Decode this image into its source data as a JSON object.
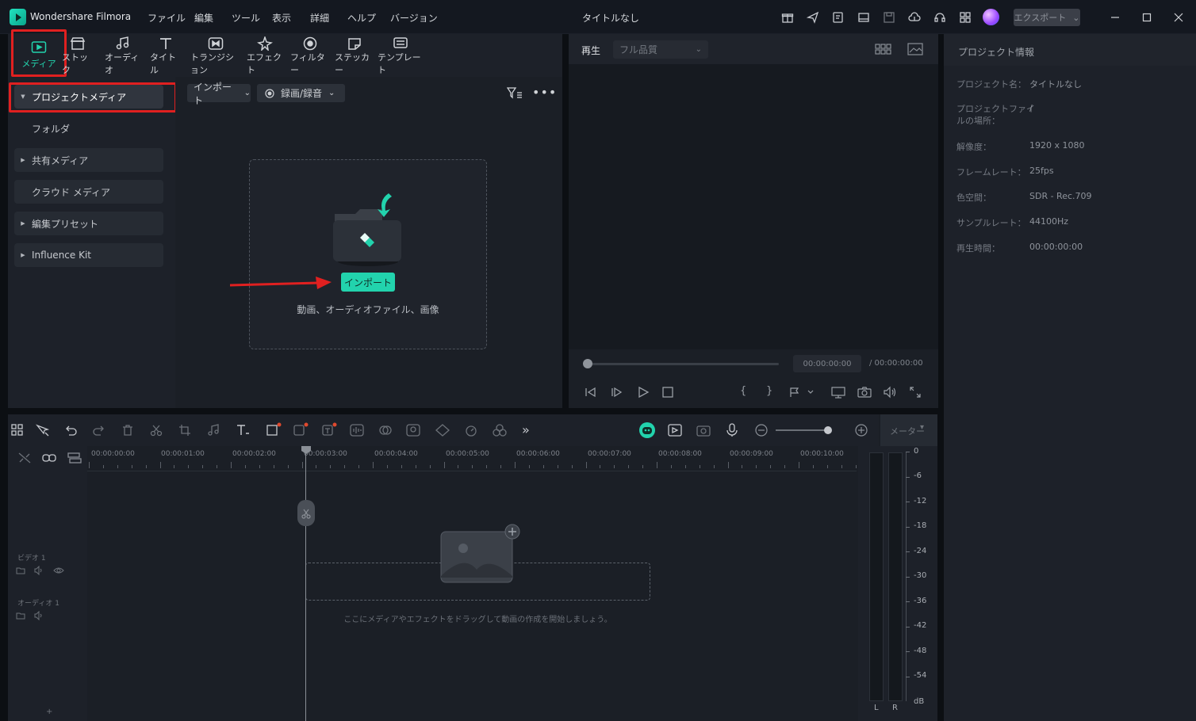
{
  "app": {
    "name": "Wondershare Filmora",
    "doc_title": "タイトルなし",
    "export_label": "エクスポート"
  },
  "menu": [
    "ファイル",
    "編集",
    "ツール",
    "表示",
    "詳細",
    "ヘルプ",
    "バージョン"
  ],
  "media_tabs": [
    "メディア",
    "ストック",
    "オーディオ",
    "タイトル",
    "トランジション",
    "エフェクト",
    "フィルター",
    "ステッカー",
    "テンプレート"
  ],
  "sidebar": {
    "project_media": "プロジェクトメディア",
    "folder": "フォルダ",
    "shared": "共有メディア",
    "cloud": "クラウド メディア",
    "presets": "編集プリセット",
    "influence": "Influence Kit"
  },
  "media_toolbar": {
    "import_dd": "インポート",
    "record_dd": "録画/録音"
  },
  "dropzone": {
    "import_btn": "インポート",
    "hint": "動画、オーディオファイル、画像"
  },
  "preview": {
    "play_label": "再生",
    "quality": "フル品質",
    "current": "00:00:00:00",
    "total": "/ 00:00:00:00"
  },
  "info": {
    "title": "プロジェクト情報",
    "rows": [
      {
        "k": "プロジェクト名：",
        "v": "タイトルなし"
      },
      {
        "k": "プロジェクトファイ\nルの場所：",
        "v": "/"
      },
      {
        "k": "解像度：",
        "v": "1920 x 1080"
      },
      {
        "k": "フレームレート：",
        "v": "25fps"
      },
      {
        "k": "色空間：",
        "v": "SDR - Rec.709"
      },
      {
        "k": "サンプルレート：",
        "v": "44100Hz"
      },
      {
        "k": "再生時間：",
        "v": "00:00:00:00"
      }
    ]
  },
  "timeline": {
    "ruler": [
      "00:00:00:00",
      "00:00:01:00",
      "00:00:02:00",
      "00:00:03:00",
      "00:00:04:00",
      "00:00:05:00",
      "00:00:06:00",
      "00:00:07:00",
      "00:00:08:00",
      "00:00:09:00",
      "00:00:10:00"
    ],
    "video_track": "ビデオ 1",
    "audio_track": "オーディオ 1",
    "drop_hint": "ここにメディアやエフェクトをドラッグして動画の作成を開始しましょう。",
    "meter_label": "メーター"
  },
  "meter": {
    "scale": [
      "0",
      "-6",
      "-12",
      "-18",
      "-24",
      "-30",
      "-36",
      "-42",
      "-48",
      "-54",
      "dB"
    ],
    "left": "L",
    "right": "R"
  },
  "colors": {
    "accent": "#22d3ad",
    "highlight": "#e02020"
  }
}
